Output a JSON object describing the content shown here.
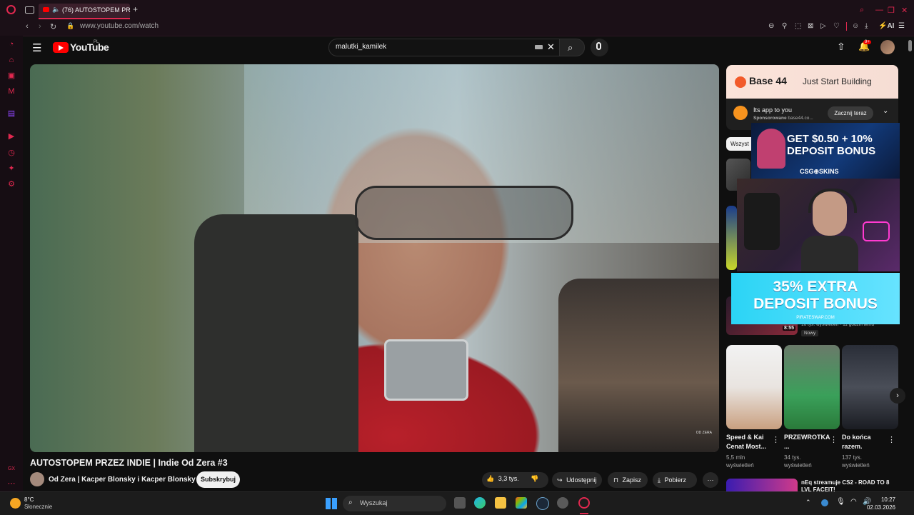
{
  "browser": {
    "tab_title": "(76) AUTOSTOPEM PR",
    "new_tab": "+",
    "url": "www.youtube.com/watch",
    "ai_label": "AI"
  },
  "sidebar": {
    "gx_label": "GX"
  },
  "youtube": {
    "logo_text": "YouTube",
    "region": "PL",
    "search_value": "malutki_kamilek",
    "notifications_badge": "9+"
  },
  "video": {
    "watermark": "OD ZERA",
    "title": "AUTOSTOPEM PRZEZ INDIE | Indie Od Zera #3",
    "channel": "Od Zera | Kacper Blonsky i Kacper Blonsky",
    "subscribe_label": "Subskrybuj",
    "likes": "3,3 tys.",
    "share_label": "Udostępnij",
    "save_label": "Zapisz",
    "download_label": "Pobierz"
  },
  "ad": {
    "brand": "Base 44",
    "slogan": "Just Start Building",
    "headline": "Its app to you",
    "sponsored": "Sponsorowane",
    "domain": "base44.co...",
    "cta": "Zacznij teraz"
  },
  "chips": {
    "first": "Wszyst"
  },
  "overlays": {
    "csg_promo_line1": "GET $0.50 + 10%",
    "csg_promo_line2": "DEPOSIT BONUS",
    "csg_brand": "CSG⊕SKINS",
    "pirate_line1": "35% EXTRA",
    "pirate_line2": "DEPOSIT BONUS",
    "pirate_site": "PIRATESWAP.COM"
  },
  "recommended": {
    "visible_meta": "16 tys. wyświetleń · 11 godzin temu",
    "duration": "8:55",
    "new_badge": "Nowy"
  },
  "shorts": [
    {
      "title": "Speed & Kai Cenat Most...",
      "views": "5,5 mln wyświetleń"
    },
    {
      "title": "PRZEWROTKA ...",
      "views": "34 tys. wyświetleń"
    },
    {
      "title": "Do końca razem.",
      "views": "137 tys. wyświetleń"
    }
  ],
  "bottom_video": {
    "title": "nEq streamuje CS2 - ROAD TO 8 LVL FACEIT!"
  },
  "taskbar": {
    "temp": "8°C",
    "weather": "Słonecznie",
    "search_placeholder": "Wyszukaj",
    "time": "10:27",
    "date": "02.03.2026"
  }
}
